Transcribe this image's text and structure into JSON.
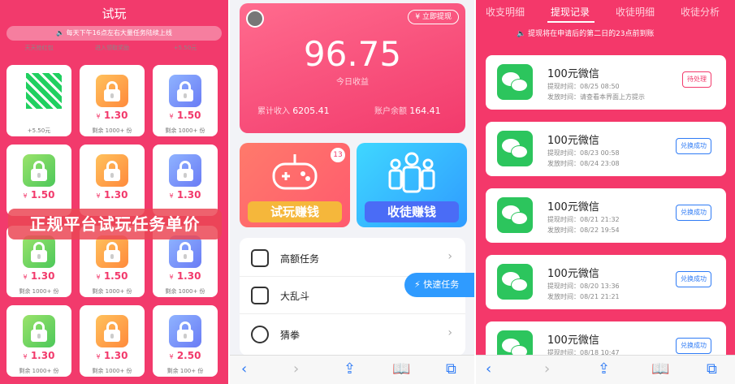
{
  "panel1": {
    "title": "试玩",
    "banner": "每天下午16点左右大量任务陆续上线",
    "top_labels": [
      "天天抢红包",
      "进入领取奖励",
      "+5.50元"
    ],
    "first_card_reward": "+5.50元",
    "overlay": "正规平台试玩任务单价",
    "cards": [
      {
        "price": "1.30",
        "remain": "剩余 1000+ 份",
        "color": "orange"
      },
      {
        "price": "1.50",
        "remain": "剩余 1000+ 份",
        "color": "blue"
      },
      {
        "price": "1.50",
        "remain": "",
        "color": "green"
      },
      {
        "price": "1.30",
        "remain": "",
        "color": "orange"
      },
      {
        "price": "1.30",
        "remain": "",
        "color": "blue"
      },
      {
        "price": "1.30",
        "remain": "剩余 1000+ 份",
        "color": "green"
      },
      {
        "price": "1.50",
        "remain": "剩余 1000+ 份",
        "color": "orange"
      },
      {
        "price": "1.30",
        "remain": "剩余 1000+ 份",
        "color": "blue"
      },
      {
        "price": "1.30",
        "remain": "剩余 1000+ 份",
        "color": "green"
      },
      {
        "price": "1.30",
        "remain": "剩余 1000+ 份",
        "color": "orange"
      },
      {
        "price": "2.50",
        "remain": "剩余 100+ 份",
        "color": "blue"
      }
    ],
    "yen": "¥"
  },
  "panel2": {
    "withdraw_button": "立即提现",
    "amount": "96.75",
    "amount_label": "今日收益",
    "total_income_label": "累计收入",
    "total_income": "6205.41",
    "balance_label": "账户余额",
    "balance": "164.41",
    "tile_trial": "试玩赚钱",
    "tile_trial_badge": "13",
    "tile_recruit": "收徒赚钱",
    "list": [
      "高额任务",
      "大乱斗",
      "猜拳"
    ],
    "fast_task": "快速任务",
    "chevron": "›"
  },
  "panel3": {
    "tabs": [
      "收支明细",
      "提现记录",
      "收徒明细",
      "收徒分析"
    ],
    "active_tab": "提现记录",
    "notice": "提现将在申请后的第二日的23点前到账",
    "records": [
      {
        "title": "100元微信",
        "apply": "提现时间：08/25 08:50",
        "send": "发放时间：请查看本界面上方提示",
        "status": "待处理",
        "state": "pending"
      },
      {
        "title": "100元微信",
        "apply": "提现时间：08/23 00:58",
        "send": "发放时间：08/24 23:08",
        "status": "兑换成功",
        "state": "done"
      },
      {
        "title": "100元微信",
        "apply": "提现时间：08/21 21:32",
        "send": "发放时间：08/22 19:54",
        "status": "兑换成功",
        "state": "done"
      },
      {
        "title": "100元微信",
        "apply": "提现时间：08/20 13:36",
        "send": "发放时间：08/21 21:21",
        "status": "兑换成功",
        "state": "done"
      },
      {
        "title": "100元微信",
        "apply": "提现时间：08/18 10:47",
        "send": "",
        "status": "兑换成功",
        "state": "done"
      }
    ]
  },
  "browser_bar": {
    "back": "‹",
    "forward": "›",
    "share": "⇪",
    "book": "📖",
    "tabs": "⧉"
  }
}
